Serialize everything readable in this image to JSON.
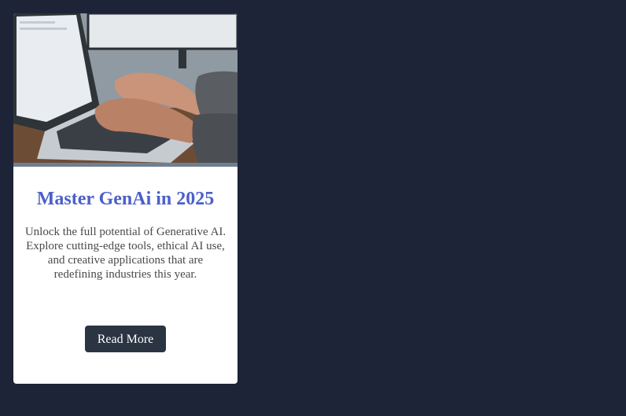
{
  "card": {
    "title": "Master GenAi in 2025",
    "description": "Unlock the full potential of Generative AI. Explore cutting-edge tools, ethical AI use, and creative applications that are redefining industries this year.",
    "button_label": "Read More"
  },
  "colors": {
    "page_background": "#1d2438",
    "title": "#4c5fc9",
    "button": "#2b3442"
  }
}
